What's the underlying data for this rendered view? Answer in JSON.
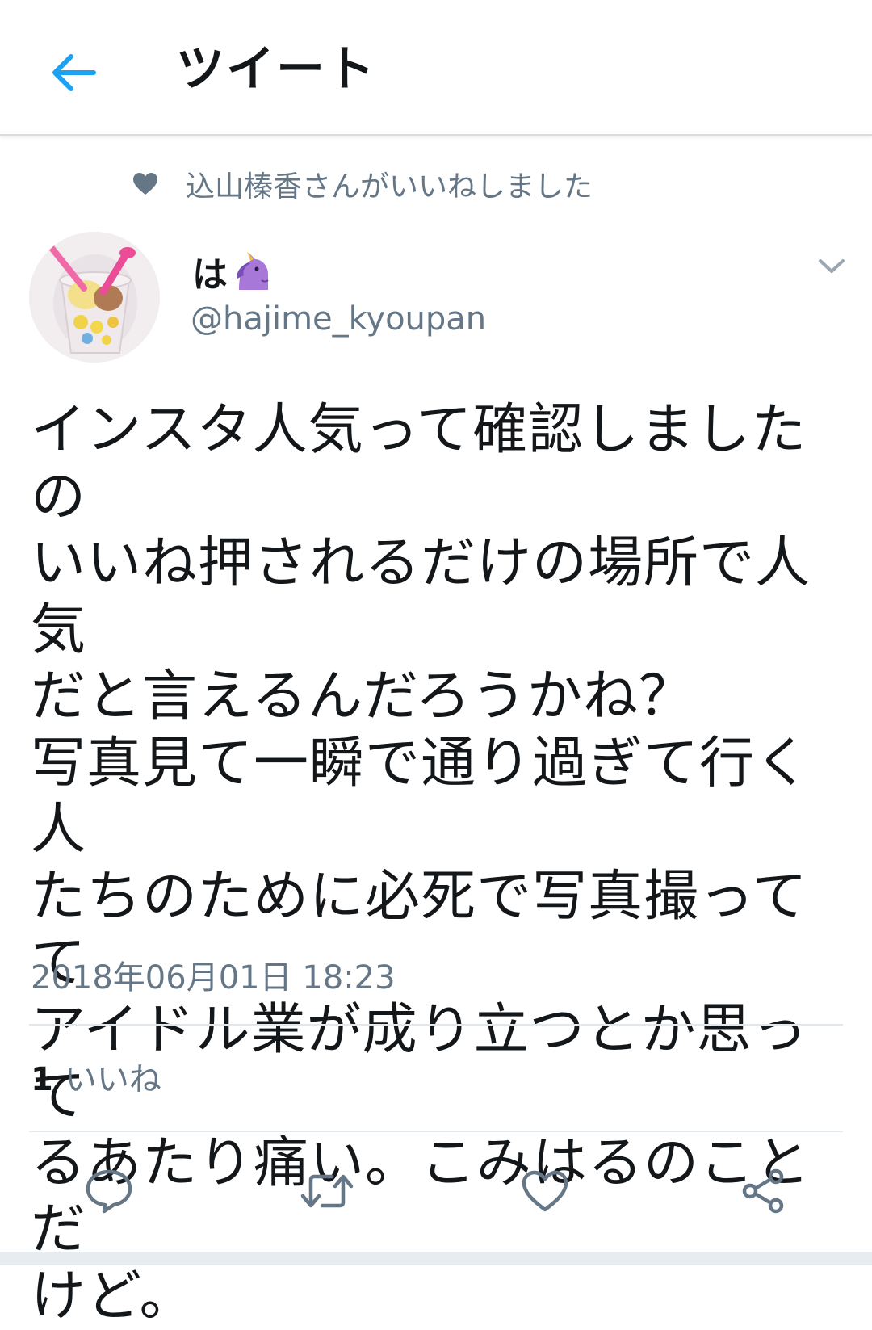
{
  "header": {
    "title": "ツイート",
    "back_icon": "back-arrow-icon",
    "accent_color": "#1da1f2"
  },
  "social_context": {
    "text": "込山榛香さんがいいねしました",
    "icon": "heart-icon"
  },
  "tweet": {
    "display_name": "は",
    "name_emoji": "unicorn-emoji",
    "handle": "@hajime_kyoupan",
    "text": "インスタ人気って確認しましたの\nいいね押されるだけの場所で人気\nだと言えるんだろうかね？\n写真見て一瞬で通り過ぎて行く人\nたちのために必死で写真撮ってて\nアイドル業が成り立つとか思って\nるあたり痛い。こみはるのことだ\nけど。",
    "timestamp": "2018年06月01日 18:23"
  },
  "stats": {
    "likes_count": "1",
    "likes_label": "いいね"
  },
  "actions": [
    {
      "name": "reply",
      "icon": "reply-icon"
    },
    {
      "name": "retweet",
      "icon": "retweet-icon"
    },
    {
      "name": "like",
      "icon": "heart-outline-icon"
    },
    {
      "name": "share",
      "icon": "share-icon"
    }
  ],
  "colors": {
    "text_primary": "#14171a",
    "text_secondary": "#657786",
    "divider": "#e1e8ed"
  }
}
